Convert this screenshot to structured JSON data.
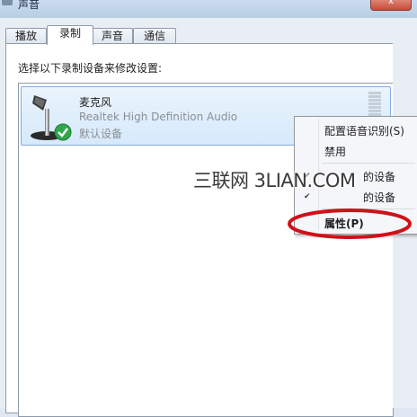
{
  "window": {
    "title": "声音",
    "close_label": "x"
  },
  "tabs": [
    {
      "label": "播放",
      "active": false
    },
    {
      "label": "录制",
      "active": true
    },
    {
      "label": "声音",
      "active": false
    },
    {
      "label": "通信",
      "active": false
    }
  ],
  "instruction": "选择以下录制设备来修改设置:",
  "device": {
    "name": "麦克风",
    "description": "Realtek High Definition Audio",
    "status": "默认设备",
    "icon": "microphone-icon",
    "status_icon": "green-check-icon"
  },
  "context_menu": {
    "items": [
      "配置语音识别(S)",
      "禁用",
      "的设备",
      "的设备",
      "属性(P)"
    ],
    "bold_item": "属性(P)"
  },
  "watermark": "三联网 3LIAN.COM",
  "colors": {
    "selection": "#d6e9fb",
    "annotation": "#d0101a",
    "check": "#2ea84a"
  }
}
